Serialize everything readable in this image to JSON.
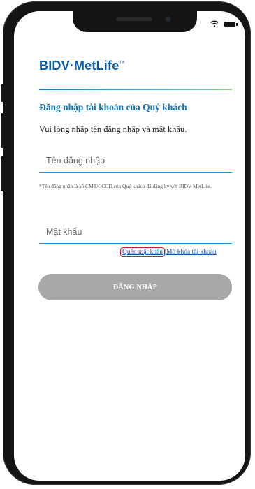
{
  "brand": {
    "name": "BIDV·MetLife",
    "trademark": "™",
    "accent": "#1576b5",
    "logo_color": "#0a5ca8"
  },
  "status_bar": {
    "wifi_icon": "wifi-icon",
    "battery_icon": "battery-icon"
  },
  "login": {
    "title": "Đăng nhập tài khoản của Quý khách",
    "subtitle": "Vui lòng nhập tên đăng nhập và mật khẩu.",
    "username": {
      "placeholder": "Tên đăng nhập",
      "value": ""
    },
    "username_note": "*Tên đăng nhập là số CMT/CCCD của Quý khách đã đăng ký với BIDV MetLife.",
    "password": {
      "placeholder": "Mật khẩu",
      "value": ""
    },
    "forgot_password_label": "Quên mật khẩu",
    "separator": "|",
    "unlock_account_label": "Mở khóa tài khoản",
    "submit_label": "ĐĂNG NHẬP",
    "submit_color": "#a8a8a8",
    "highlight_color": "#c21f2a"
  }
}
